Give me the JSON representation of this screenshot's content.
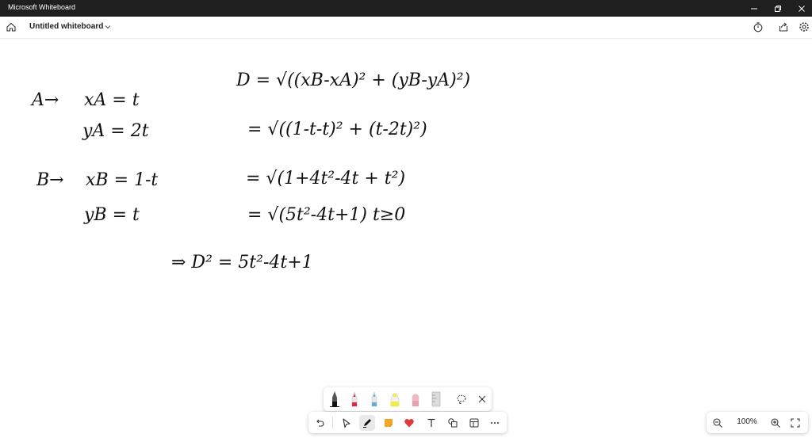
{
  "window": {
    "title": "Microsoft Whiteboard"
  },
  "header": {
    "document_title": "Untitled whiteboard"
  },
  "canvas": {
    "left_block": [
      {
        "label": "A→",
        "lines": [
          "xA = t",
          "yA = 2t"
        ]
      },
      {
        "label": "B→",
        "lines": [
          "xB = 1-t",
          "yB = t"
        ]
      }
    ],
    "derivation": [
      "D = √((xB-xA)² + (yB-yA)²)",
      "= √((1-t-t)² + (t-2t)²)",
      "= √(1+4t²-4t + t²)",
      "= √(5t²-4t+1)   t≥0",
      "⇒ D² = 5t²-4t+1"
    ]
  },
  "pens_tray": {
    "pens": [
      {
        "name": "black-pen",
        "color": "#111111",
        "selected": true
      },
      {
        "name": "red-pen",
        "color": "#e0244a"
      },
      {
        "name": "blue-pen",
        "color": "#6aa8d8"
      },
      {
        "name": "yellow-highlighter",
        "color": "#f4ec3a"
      },
      {
        "name": "pink-pen",
        "color": "#f0b8c4"
      },
      {
        "name": "ruler",
        "color": "#b9b9b9"
      }
    ],
    "icons": [
      "lasso-icon",
      "close-icon"
    ]
  },
  "toolbar": {
    "tools": [
      "undo-icon",
      "select-icon",
      "pen-icon",
      "note-icon",
      "reactions-icon",
      "text-icon",
      "shapes-icon",
      "templates-icon",
      "more-icon"
    ],
    "active": "pen-icon",
    "heart_color": "#e03a3a",
    "note_color": "#f5a623"
  },
  "zoom": {
    "value": "100%"
  },
  "colors": {
    "titlebar": "#1f1f1f",
    "ink": "#111111"
  }
}
